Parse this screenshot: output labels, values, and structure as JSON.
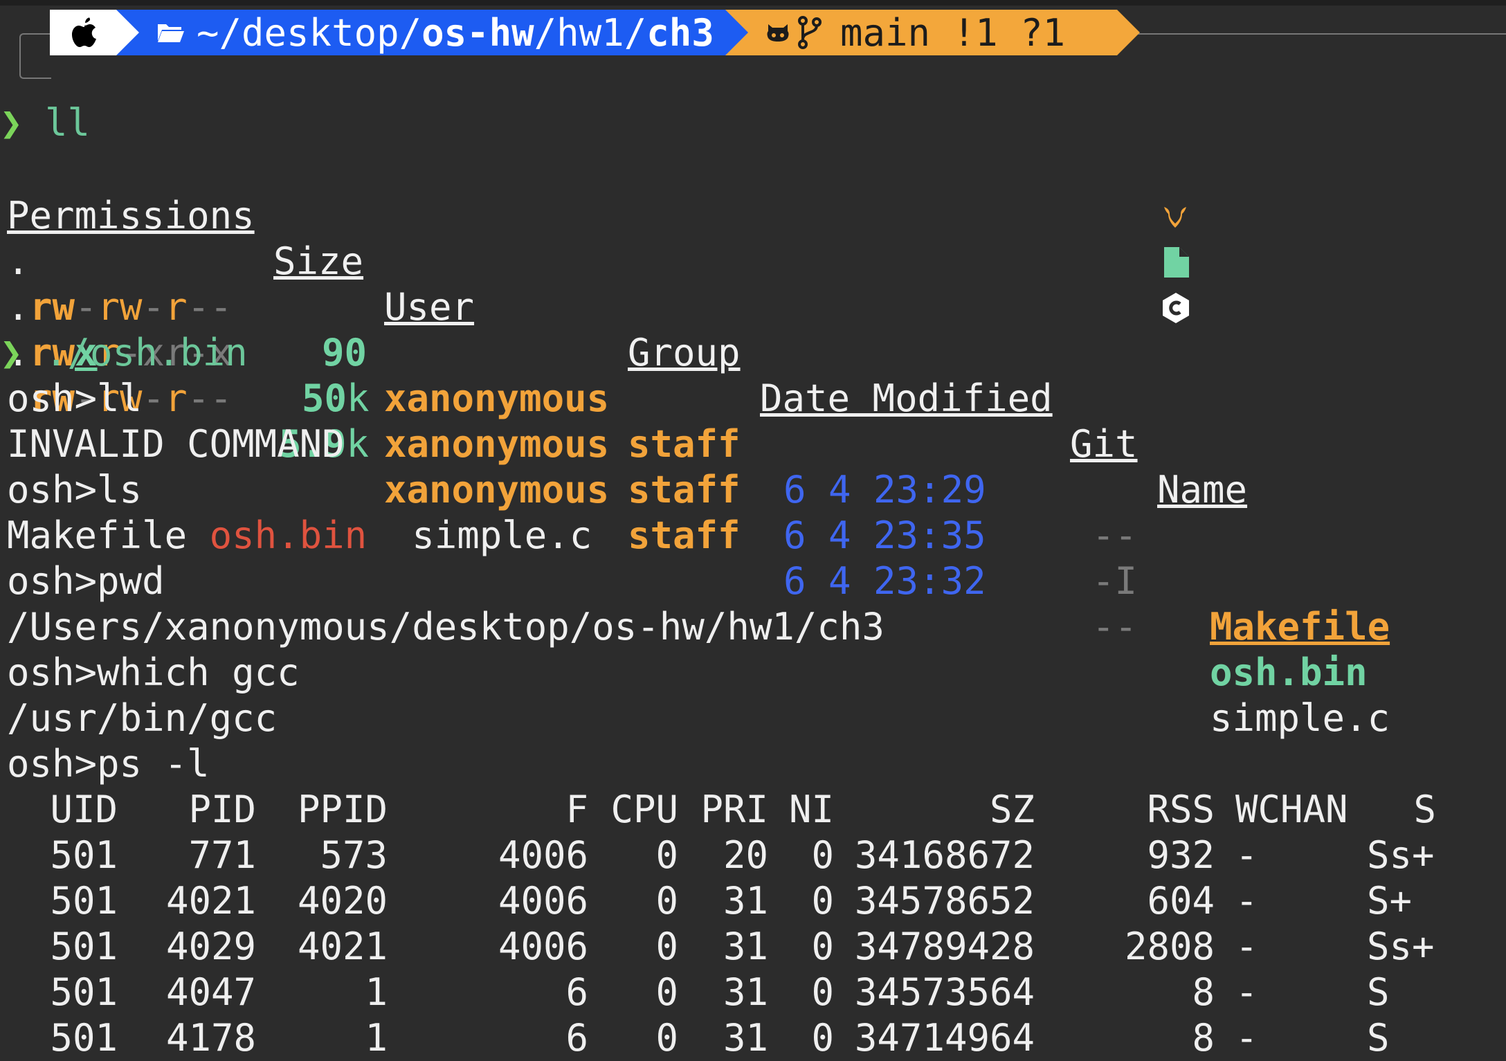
{
  "prompt": {
    "path_prefix": "~/desktop/",
    "path_bold1": "os-hw",
    "path_sep": "/hw1/",
    "path_bold2": "ch3",
    "branch": "main",
    "status": "!1 ?1"
  },
  "cmd1": "ll",
  "ls_headers": [
    "Permissions",
    "Size",
    "User",
    "Group",
    "Date Modified",
    "Git",
    "Name"
  ],
  "ls_rows": [
    {
      "perm_dot": ".",
      "perm": "rw-rw-r--",
      "size_num": "90",
      "size_unit": "",
      "user": "xanonymous",
      "group": "staff",
      "date": "6 4 23:29",
      "git": "--",
      "name": "Makefile"
    },
    {
      "perm_dot": ".",
      "perm": "rwxr-xr-x",
      "size_num": "50",
      "size_unit": "k",
      "user": "xanonymous",
      "group": "staff",
      "date": "6 4 23:35",
      "git": "-I",
      "name": "osh.bin"
    },
    {
      "perm_dot": ".",
      "perm": "rw-rw-r--",
      "size_num": "5.9",
      "size_unit": "k",
      "user": "xanonymous",
      "group": "staff",
      "date": "6 4 23:32",
      "git": "--",
      "name": "simple.c"
    }
  ],
  "cmd2": "./osh.bin",
  "osh": {
    "l1": "osh>ll",
    "l2": "INVALID COMMAND",
    "l3": "osh>ls",
    "ls_makefile": "Makefile",
    "ls_oshbin": "osh.bin",
    "ls_simple": "simple.c",
    "l5": "osh>pwd",
    "l6": "/Users/xanonymous/desktop/os-hw/hw1/ch3",
    "l7": "osh>which gcc",
    "l8": "/usr/bin/gcc",
    "l9": "osh>ps -l"
  },
  "ps_headers": [
    "UID",
    "PID",
    "PPID",
    "F",
    "CPU",
    "PRI",
    "NI",
    "SZ",
    "RSS",
    "WCHAN",
    "S"
  ],
  "ps_rows": [
    [
      "501",
      "771",
      "573",
      "4006",
      "0",
      "20",
      "0",
      "34168672",
      "932",
      "-",
      "Ss+"
    ],
    [
      "501",
      "4021",
      "4020",
      "4006",
      "0",
      "31",
      "0",
      "34578652",
      "604",
      "-",
      "S+"
    ],
    [
      "501",
      "4029",
      "4021",
      "4006",
      "0",
      "31",
      "0",
      "34789428",
      "2808",
      "-",
      "Ss+"
    ],
    [
      "501",
      "4047",
      "1",
      "6",
      "0",
      "31",
      "0",
      "34573564",
      "8",
      "-",
      "S"
    ],
    [
      "501",
      "4178",
      "1",
      "6",
      "0",
      "31",
      "0",
      "34714964",
      "8",
      "-",
      "S"
    ]
  ]
}
